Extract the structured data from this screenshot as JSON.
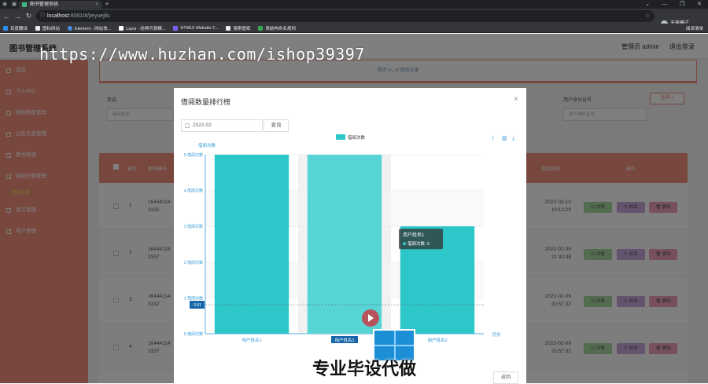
{
  "browser": {
    "tab_title": "图书管理系统",
    "address_host": "localhost",
    "address_path": ":8081/#/jieyuejilu",
    "profile_label": "无痕模式",
    "bookmarks": [
      "百度翻译",
      "图标网站",
      "Element - 网站快...",
      "Layui - 经典开源模...",
      "HTML5 Website T...",
      "搜索壁纸",
      "表结构命名规则"
    ],
    "bookmark_colors": [
      "#2d8cf0",
      "#e8eaed",
      "#4a90e2",
      "#ffffff",
      "#7b61ff",
      "#e8eaed",
      "#34a853"
    ],
    "reading_list": "阅读清单"
  },
  "app": {
    "title": "图书管理系统",
    "admin_label": "管理员 admin",
    "logout_label": "退出登录",
    "sidebar": [
      {
        "label": "首页"
      },
      {
        "label": "个人中心"
      },
      {
        "label": "借阅类型管理"
      },
      {
        "label": "公告信息管理"
      },
      {
        "label": "图书管理"
      },
      {
        "label": "借阅记录管理"
      }
    ],
    "sidebar_sub": "借阅记录",
    "sidebar_after": [
      {
        "label": "留言管理"
      },
      {
        "label": "用户管理"
      }
    ],
    "breadcrumb": "首页 (•◡•) 借阅记录",
    "filters": {
      "status_label": "状态",
      "status_placeholder": "借阅状态",
      "idcard_label": "用户身份证号",
      "idcard_placeholder": "用户身份证号",
      "search_label": "查询 ⌕"
    },
    "table": {
      "headers": [
        "索引",
        "图书编号",
        "借阅时间",
        "操作"
      ],
      "rows": [
        {
          "index": "1",
          "code": [
            "16444114",
            "3332"
          ],
          "time": [
            "2022-02-10",
            "10:12:20"
          ]
        },
        {
          "index": "2",
          "code": [
            "16444114",
            "3337"
          ],
          "time": [
            "2022-02-09",
            "21:32:48"
          ]
        },
        {
          "index": "3",
          "code": [
            "16444114",
            "3332"
          ],
          "time": [
            "2022-02-09",
            "20:57:32"
          ]
        },
        {
          "index": "4",
          "code": [
            "16444114",
            "3337"
          ],
          "time": [
            "2022-02-09",
            "20:57:32"
          ]
        }
      ],
      "actions": {
        "detail": "详情",
        "edit": "修改",
        "delete": "删除"
      }
    }
  },
  "dialog": {
    "title": "借阅数量排行榜",
    "date_value": "2022-02",
    "query_label": "查询",
    "back_label": "返回",
    "close_label": "×"
  },
  "chart_data": {
    "type": "bar",
    "categories": [
      "用户姓名1",
      "用户姓名1",
      "用户姓名2"
    ],
    "series": [
      {
        "name": "借阅次数",
        "values": [
          5,
          5,
          3
        ]
      }
    ],
    "ylabel": "借阅次数",
    "xlabel": "月份",
    "ylim": [
      0,
      5
    ],
    "y_ticks": [
      "0 借阅次数",
      "1 借阅次数",
      "2 借阅次数",
      "3 借阅次数",
      "4 借阅次数",
      "5 借阅次数"
    ],
    "legend_position": "top-center",
    "bar_color": "#2ec7c9",
    "highlight_index": 1,
    "highlight_color": "#56d4d6",
    "crosshair_value": 0.81,
    "crosshair_label": "0.81",
    "tooltip": {
      "title": "用户姓名1",
      "item": "借阅次数: 5"
    }
  },
  "overlay": {
    "watermark": "https://www.huzhan.com/ishop39397",
    "promo": "专业毕设代做"
  }
}
